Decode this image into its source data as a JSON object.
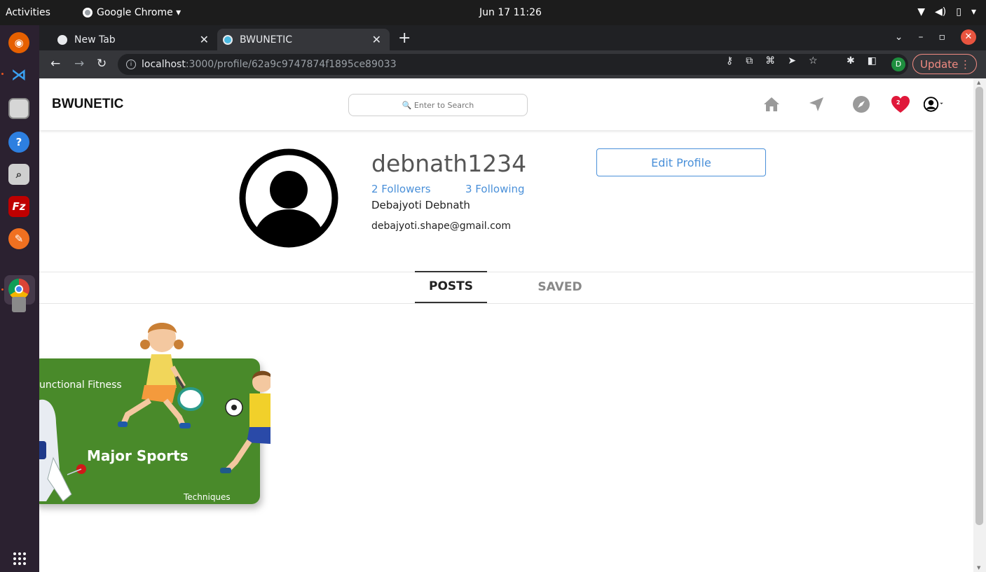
{
  "system": {
    "activities": "Activities",
    "app_menu": "Google Chrome ▾",
    "clock": "Jun 17  11:26",
    "tray_icons": [
      "wifi-icon",
      "volume-icon",
      "battery-icon",
      "system-menu-icon"
    ]
  },
  "dock": {
    "apps": [
      "firefox-icon",
      "vscode-icon",
      "files-icon",
      "help-icon",
      "screenshot-icon",
      "filezilla-icon",
      "compass-icon",
      "chrome-icon",
      "usb-icon"
    ],
    "show_apps_icon": "apps-grid-icon"
  },
  "browser": {
    "tabs": [
      {
        "title": "New Tab",
        "active": false
      },
      {
        "title": "BWUNETIC",
        "active": true
      }
    ],
    "new_tab": "+",
    "url_host": "localhost",
    "url_path": ":3000/profile/62a9c9747874f1895ce89033",
    "profile_initial": "D",
    "update_label": "Update"
  },
  "app": {
    "logo": "BWUNETIC",
    "search_placeholder": "🔍 Enter to Search",
    "notification_count": "2",
    "accent_color": "#4a90d9"
  },
  "profile": {
    "username": "debnath1234",
    "followers": "2 Followers",
    "following": "3 Following",
    "full_name": "Debajyoti Debnath",
    "email": "debajyoti.shape@gmail.com",
    "edit_button": "Edit Profile"
  },
  "tabs": {
    "posts": "POSTS",
    "saved": "SAVED"
  },
  "post": {
    "title": "Major Sports",
    "subtitle": "unctional Fitness",
    "caption": "Techniques",
    "card_color": "#4a8a2a"
  }
}
